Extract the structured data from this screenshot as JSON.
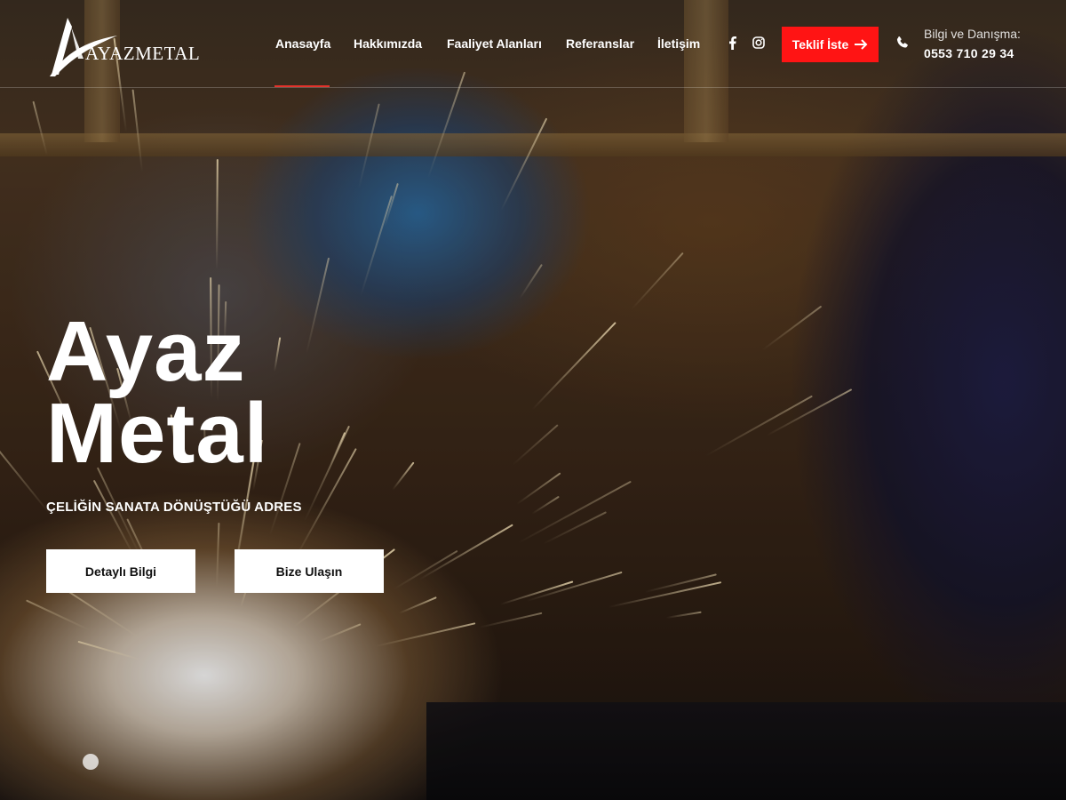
{
  "brand": {
    "logo_text": "AYAZMETAL"
  },
  "nav": {
    "items": [
      {
        "label": "Anasayfa",
        "active": true
      },
      {
        "label": "Hakkımızda"
      },
      {
        "label": "Faaliyet Alanları"
      },
      {
        "label": "Referanslar"
      },
      {
        "label": "İletişim"
      }
    ]
  },
  "social": [
    {
      "icon": "facebook-icon"
    },
    {
      "icon": "instagram-icon"
    }
  ],
  "cta": {
    "label": "Teklif İste",
    "icon": "arrow-right-icon",
    "color": "#ff1414"
  },
  "contact": {
    "icon": "phone-icon",
    "label": "Bilgi ve Danışma:",
    "phone": "0553 710 29 34"
  },
  "hero": {
    "title_line1": "Ayaz",
    "title_line2": "Metal",
    "subtitle": "ÇELİĞİN SANATA DÖNÜŞTÜĞÜ ADRES",
    "buttons": [
      {
        "label": "Detaylı Bilgi"
      },
      {
        "label": "Bize Ulaşın"
      }
    ]
  },
  "colors": {
    "accent": "#e4322b",
    "button_bg": "#ffffff"
  }
}
